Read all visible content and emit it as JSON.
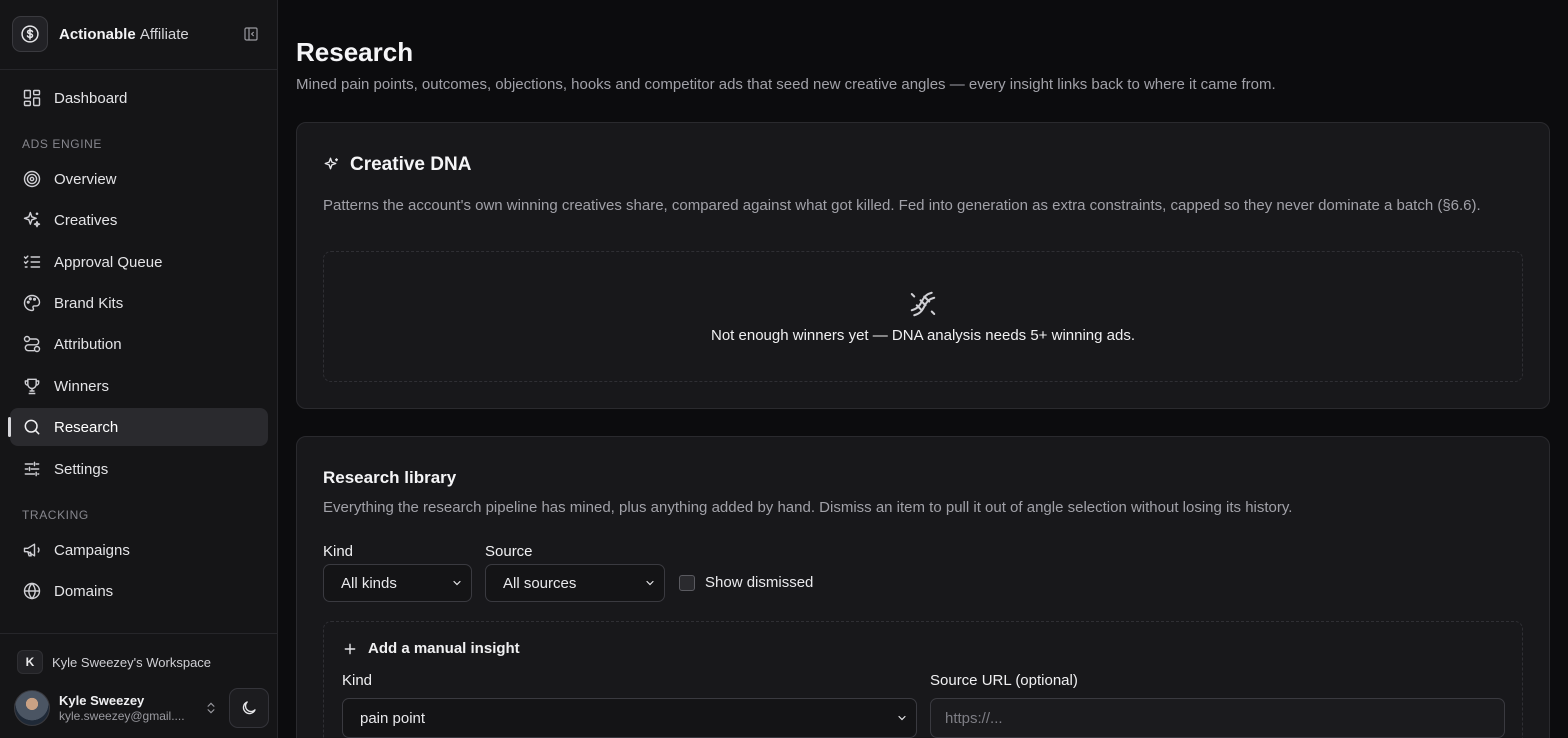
{
  "brand": {
    "name_bold": "Actionable",
    "name_light": "Affiliate"
  },
  "nav": {
    "dashboard": "Dashboard",
    "section_ads": "ADS ENGINE",
    "overview": "Overview",
    "creatives": "Creatives",
    "approval_queue": "Approval Queue",
    "brand_kits": "Brand Kits",
    "attribution": "Attribution",
    "winners": "Winners",
    "research": "Research",
    "settings": "Settings",
    "section_tracking": "TRACKING",
    "campaigns": "Campaigns",
    "domains": "Domains",
    "active": "research"
  },
  "workspace": {
    "initial": "K",
    "name": "Kyle Sweezey's Workspace"
  },
  "user": {
    "name": "Kyle Sweezey",
    "email": "kyle.sweezey@gmail...."
  },
  "page": {
    "title": "Research",
    "subtitle": "Mined pain points, outcomes, objections, hooks and competitor ads that seed new creative angles — every insight links back to where it came from."
  },
  "dna": {
    "title": "Creative DNA",
    "description": "Patterns the account's own winning creatives share, compared against what got killed. Fed into generation as extra constraints, capped so they never dominate a batch (§6.6).",
    "empty_text": "Not enough winners yet — DNA analysis needs 5+ winning ads."
  },
  "library": {
    "title": "Research library",
    "description": "Everything the research pipeline has mined, plus anything added by hand. Dismiss an item to pull it out of angle selection without losing its history.",
    "kind_label": "Kind",
    "kind_value": "All kinds",
    "source_label": "Source",
    "source_value": "All sources",
    "show_dismissed": "Show dismissed"
  },
  "manual": {
    "title": "Add a manual insight",
    "kind_label": "Kind",
    "kind_value": "pain point",
    "source_url_label": "Source URL (optional)",
    "source_url_placeholder": "https://..."
  }
}
